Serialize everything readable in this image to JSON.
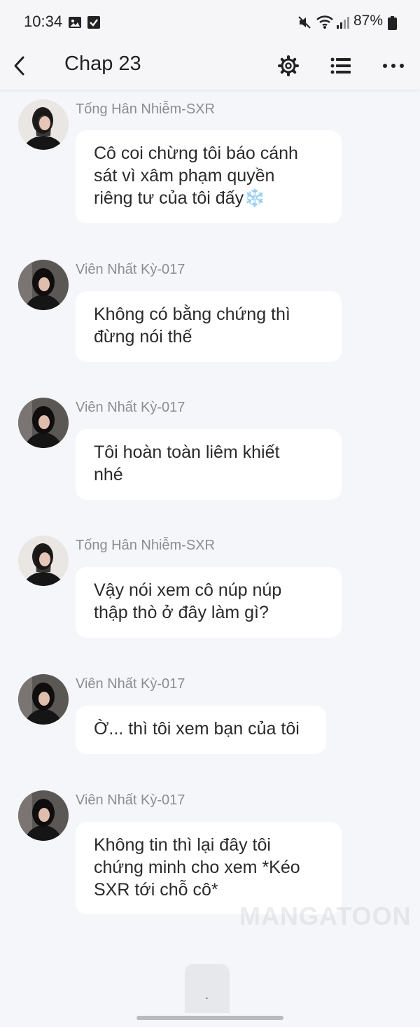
{
  "status_bar": {
    "time": "10:34",
    "battery": "87%",
    "icons": [
      "image-icon",
      "check-square-icon",
      "mute-icon",
      "wifi-icon",
      "signal-icon",
      "battery-icon"
    ]
  },
  "app_bar": {
    "title": "Chap 23",
    "back_icon": "back-arrow-icon",
    "settings_icon": "gear-icon",
    "list_icon": "list-icon",
    "more_icon": "more-icon"
  },
  "messages": [
    {
      "sender": "Tống Hân Nhiễm-SXR",
      "text": "Cô coi chừng tôi báo cánh\nsát vì xâm phạm quyền\nriêng tư của tôi đấy❄️"
    },
    {
      "sender": "Viên Nhất Kỳ-017",
      "text": "Không có bằng chứng thì\nđừng nói thế"
    },
    {
      "sender": "Viên Nhất Kỳ-017",
      "text": "Tôi hoàn toàn liêm khiết\nnhé"
    },
    {
      "sender": "Tống Hân Nhiễm-SXR",
      "text": "Vậy nói xem cô núp núp\nthập thò ở đây làm gì?"
    },
    {
      "sender": "Viên Nhất Kỳ-017",
      "text": "Ờ... thì tôi xem bạn của tôi"
    },
    {
      "sender": "Viên Nhất Kỳ-017",
      "text": "Không tin thì lại đây tôi\nchứng minh cho xem *Kéo\nSXR tới chỗ cô*"
    }
  ],
  "watermark": "MANGATOON",
  "next_tab_text": ".",
  "colors": {
    "background": "#f5f6f9",
    "bubble": "#ffffff",
    "sender_name": "#8a8d93",
    "text": "#2a2a2a"
  }
}
